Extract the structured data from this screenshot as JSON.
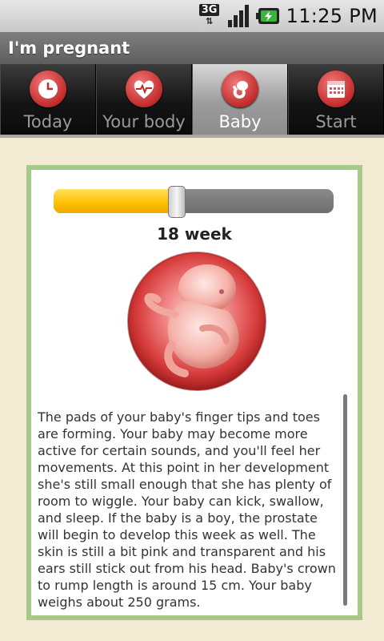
{
  "status": {
    "network": "3G",
    "time": "11:25 PM"
  },
  "app": {
    "title": "I'm pregnant"
  },
  "tabs": [
    {
      "label": "Today",
      "icon": "clock-icon",
      "selected": false
    },
    {
      "label": "Your body",
      "icon": "heart-icon",
      "selected": false
    },
    {
      "label": "Baby",
      "icon": "baby-icon",
      "selected": true
    },
    {
      "label": "Start",
      "icon": "calendar-icon",
      "selected": false
    }
  ],
  "week": {
    "label": "18 week",
    "progress": 0.44
  },
  "baby_image": "fetus-in-womb-illustration",
  "description": "The pads of your baby's finger tips and toes are forming. Your baby may become more active for certain sounds, and you'll feel her movements. At this point in her development she's still small enough that she has plenty of room to wiggle. Your baby can kick, swallow, and sleep. If the baby is a boy, the prostate will begin to develop this week as well. The skin is still a bit pink and transparent and his ears still stick out from his head. Baby's crown to rump length is around 15 cm. Your baby weighs about 250 grams.",
  "colors": {
    "accent_yellow": "#ffbe00",
    "card_border": "#a6c888",
    "background": "#f3ead4",
    "icon_red": "#c22b2b"
  }
}
